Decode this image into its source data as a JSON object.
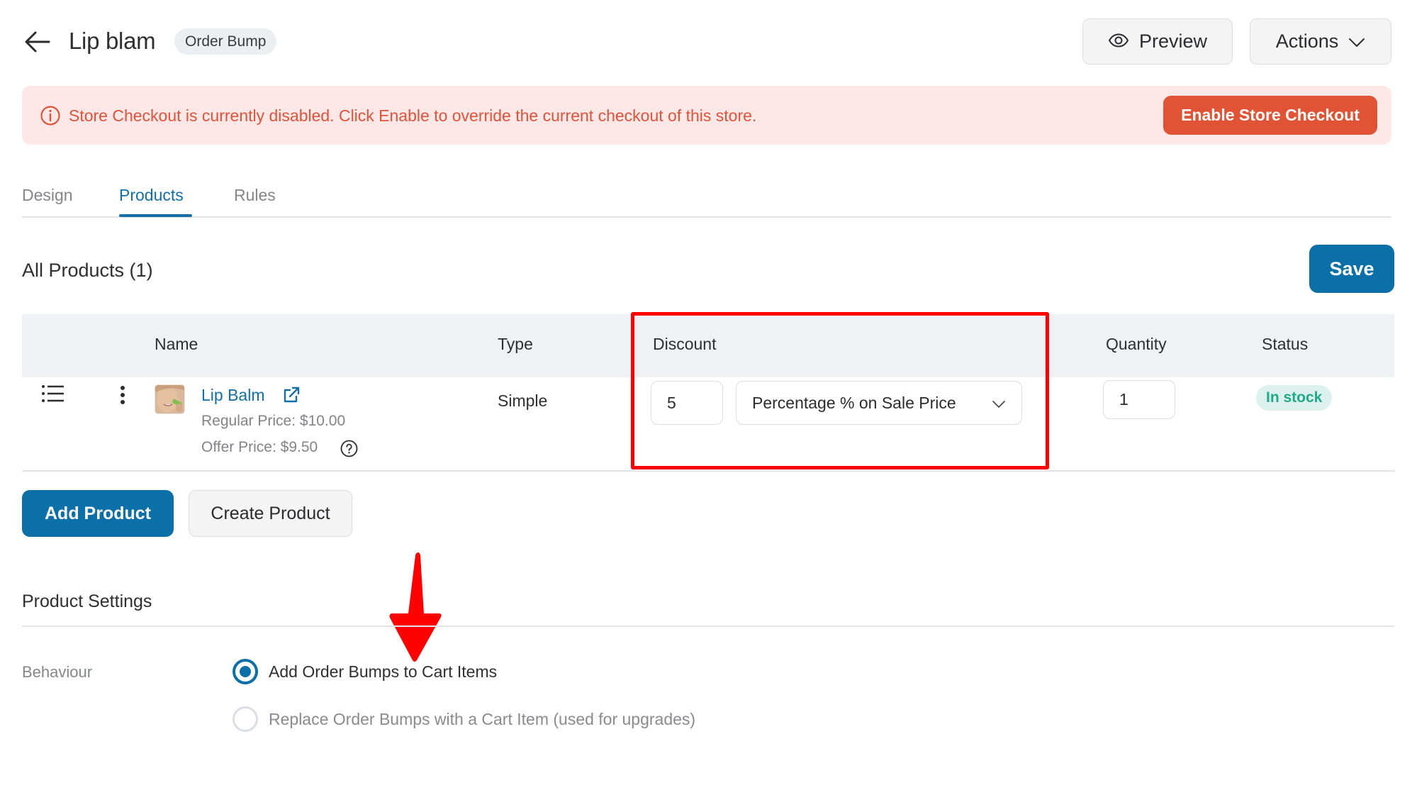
{
  "header": {
    "title": "Lip blam",
    "type_badge": "Order Bump",
    "preview_label": "Preview",
    "actions_label": "Actions",
    "icons": {
      "back": "arrow-left-icon",
      "preview": "eye-icon",
      "actions": "chevron-down-icon"
    }
  },
  "banner": {
    "message": "Store Checkout is currently disabled. Click Enable to override the current checkout of this store.",
    "button_label": "Enable Store Checkout",
    "icon": "info-circle-icon",
    "color": "#e0533a",
    "background": "#fde7e7"
  },
  "tabs": [
    {
      "label": "Design",
      "active": false
    },
    {
      "label": "Products",
      "active": true
    },
    {
      "label": "Rules",
      "active": false
    }
  ],
  "products": {
    "title": "All Products (1)",
    "save_label": "Save",
    "columns": [
      "Name",
      "Type",
      "Discount",
      "Quantity",
      "Status"
    ],
    "rows": [
      {
        "name": "Lip Balm",
        "regular_price": "Regular Price: $10.00",
        "offer_price": "Offer Price: $9.50",
        "type": "Simple",
        "discount_value": "5",
        "discount_type": "Percentage % on Sale Price",
        "quantity": "1",
        "status": "In stock"
      }
    ],
    "add_product_label": "Add Product",
    "create_product_label": "Create Product"
  },
  "settings": {
    "title": "Product Settings",
    "behaviour_label": "Behaviour",
    "options": [
      {
        "label": "Add Order Bumps to Cart Items",
        "selected": true
      },
      {
        "label": "Replace Order Bumps with a Cart Item (used for upgrades)",
        "selected": false
      }
    ]
  },
  "colors": {
    "primary": "#0b6fa8",
    "danger": "#e05435",
    "success": "#22a98a",
    "annotation": "#ff0000"
  }
}
